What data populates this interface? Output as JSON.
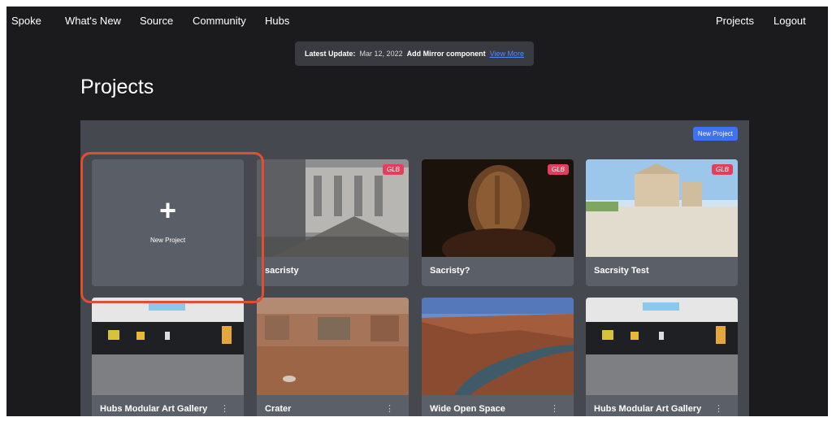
{
  "nav": {
    "left": [
      "Spoke",
      "What's New",
      "Source",
      "Community",
      "Hubs"
    ],
    "right": [
      "Projects",
      "Logout"
    ]
  },
  "update": {
    "label": "Latest Update:",
    "date": "Mar 12, 2022",
    "message": "Add Mirror component",
    "link": "View More"
  },
  "page_title": "Projects",
  "new_project_button": "New Project",
  "new_project_card": {
    "icon": "plus-icon",
    "label": "New Project"
  },
  "projects": [
    {
      "name": "sacristy",
      "badge": "GLB"
    },
    {
      "name": "Sacristy?",
      "badge": "GLB"
    },
    {
      "name": "Sacrsity Test",
      "badge": "GLB"
    },
    {
      "name": "Hubs Modular Art Gallery"
    },
    {
      "name": "Crater"
    },
    {
      "name": "Wide Open Space"
    },
    {
      "name": "Hubs Modular Art Gallery"
    }
  ],
  "highlight_color": "#e04e35",
  "accent_color": "#3e72f0",
  "badge_color": "#e0405d"
}
